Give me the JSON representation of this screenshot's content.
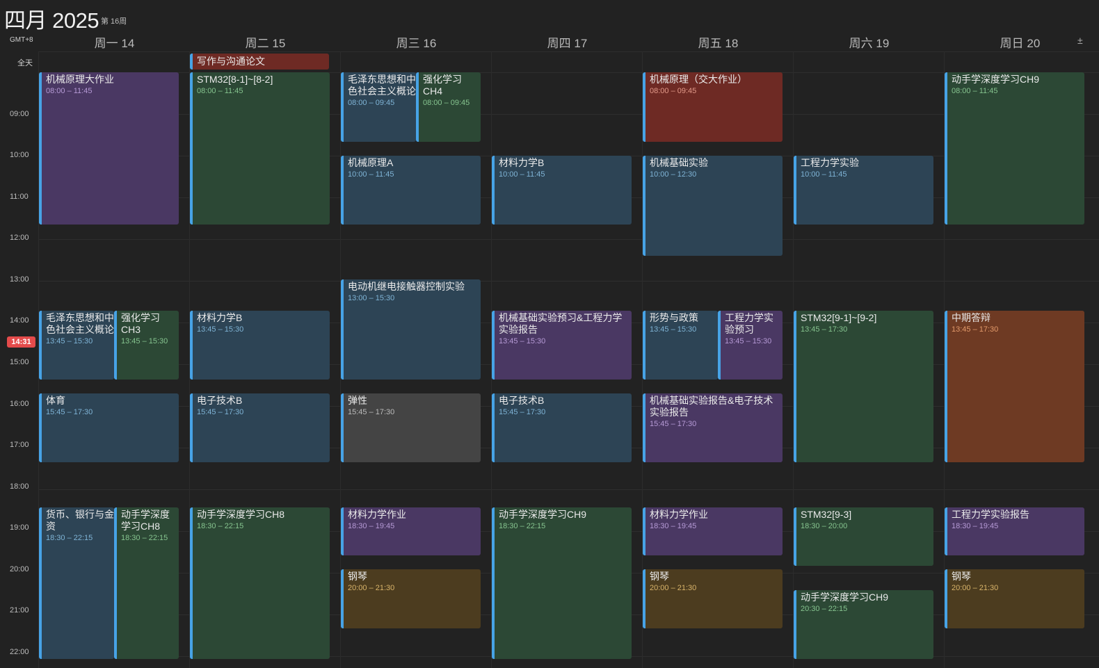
{
  "header": {
    "month": "四月",
    "year": "2025",
    "week": "第 16周",
    "timezone": "GMT+8",
    "all_day_label": "全天",
    "add_symbol": "±"
  },
  "days": [
    {
      "label": "周一 14"
    },
    {
      "label": "周二 15"
    },
    {
      "label": "周三 16"
    },
    {
      "label": "周四 17"
    },
    {
      "label": "周五 18"
    },
    {
      "label": "周六 19"
    },
    {
      "label": "周日 20"
    }
  ],
  "hours": [
    "09:00",
    "10:00",
    "11:00",
    "12:00",
    "13:00",
    "14:00",
    "15:00",
    "16:00",
    "17:00",
    "18:00",
    "19:00",
    "20:00",
    "21:00",
    "22:00"
  ],
  "now_time": "14:31",
  "all_day_events": [
    {
      "title": "写作与沟通论文",
      "day": "周二 15"
    }
  ],
  "events": [
    {
      "title": "机械原理大作业",
      "time": "08:00 – 11:45",
      "color": "#4a3863"
    },
    {
      "title": "毛泽东思想和中色社会主义概论",
      "time": "13:45 – 15:30",
      "color": "#2d4455"
    },
    {
      "title": "强化学习CH3",
      "time": "13:45 – 15:30",
      "color": "#2c4835"
    },
    {
      "title": "体育",
      "time": "15:45 – 17:30",
      "color": "#2d4455"
    },
    {
      "title": "货币、银行与金资",
      "time": "18:30 – 22:15",
      "color": "#2d4455"
    },
    {
      "title": "动手学深度学习CH8",
      "time": "18:30 – 22:15",
      "color": "#2c4835"
    },
    {
      "title": "STM32[8-1]~[8-2]",
      "time": "08:00 – 11:45",
      "color": "#2c4835"
    },
    {
      "title": "材料力学B",
      "time": "13:45 – 15:30",
      "color": "#2d4455"
    },
    {
      "title": "电子技术B",
      "time": "15:45 – 17:30",
      "color": "#2d4455"
    },
    {
      "title": "动手学深度学习CH8",
      "time": "18:30 – 22:15",
      "color": "#2c4835"
    },
    {
      "title": "毛泽东思想和中色社会主义概论",
      "time": "08:00 – 09:45",
      "color": "#2d4455"
    },
    {
      "title": "强化学习CH4",
      "time": "08:00 – 09:45",
      "color": "#2c4835"
    },
    {
      "title": "机械原理A",
      "time": "10:00 – 11:45",
      "color": "#2d4455"
    },
    {
      "title": "电动机继电接触器控制实验",
      "time": "13:00 – 15:30",
      "color": "#2d4455"
    },
    {
      "title": "弹性",
      "time": "15:45 – 17:30",
      "color": "#444444"
    },
    {
      "title": "材料力学作业",
      "time": "18:30 – 19:45",
      "color": "#4a3863"
    },
    {
      "title": "钢琴",
      "time": "20:00 – 21:30",
      "color": "#4c3c1f"
    },
    {
      "title": "材料力学B",
      "time": "10:00 – 11:45",
      "color": "#2d4455"
    },
    {
      "title": "机械基础实验预习&工程力学实验报告",
      "time": "13:45 – 15:30",
      "color": "#4a3863"
    },
    {
      "title": "电子技术B",
      "time": "15:45 – 17:30",
      "color": "#2d4455"
    },
    {
      "title": "动手学深度学习CH9",
      "time": "18:30 – 22:15",
      "color": "#2c4835"
    },
    {
      "title": "机械原理（交大作业）",
      "time": "08:00 – 09:45",
      "color": "#6e2a24"
    },
    {
      "title": "机械基础实验",
      "time": "10:00 – 12:30",
      "color": "#2d4455"
    },
    {
      "title": "形势与政策",
      "time": "13:45 – 15:30",
      "color": "#2d4455"
    },
    {
      "title": "工程力学实验预习",
      "time": "13:45 – 15:30",
      "color": "#4a3863"
    },
    {
      "title": "机械基础实验报告&电子技术实验报告",
      "time": "15:45 – 17:30",
      "color": "#4a3863"
    },
    {
      "title": "材料力学作业",
      "time": "18:30 – 19:45",
      "color": "#4a3863"
    },
    {
      "title": "钢琴",
      "time": "20:00 – 21:30",
      "color": "#4c3c1f"
    },
    {
      "title": "工程力学实验",
      "time": "10:00 – 11:45",
      "color": "#2d4455"
    },
    {
      "title": "STM32[9-1]~[9-2]",
      "time": "13:45 – 17:30",
      "color": "#2c4835"
    },
    {
      "title": "STM32[9-3]",
      "time": "18:30 – 20:00",
      "color": "#2c4835"
    },
    {
      "title": "动手学深度学习CH9",
      "time": "20:30 – 22:15",
      "color": "#2c4835"
    },
    {
      "title": "动手学深度学习CH9",
      "time": "08:00 – 11:45",
      "color": "#2c4835"
    },
    {
      "title": "中期答辩",
      "time": "13:45 – 17:30",
      "color": "#6e3a23"
    },
    {
      "title": "工程力学实验报告",
      "time": "18:30 – 19:45",
      "color": "#4a3863"
    },
    {
      "title": "钢琴",
      "time": "20:00 – 21:30",
      "color": "#4c3c1f"
    }
  ]
}
